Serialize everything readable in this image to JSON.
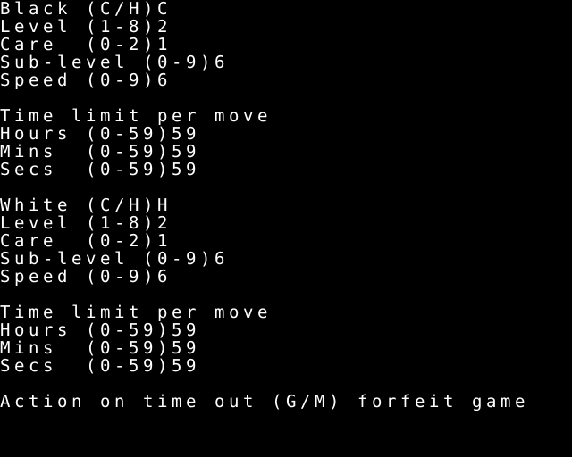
{
  "screen": {
    "title": "Chess Program Settings Screen",
    "background_color": "#000000",
    "foreground_color": "#ffffff",
    "columns": 40,
    "rows": 24,
    "char_width": 16,
    "line_height": 20
  },
  "sections": {
    "black": {
      "heading_label": "Black",
      "settings": [
        {
          "label": "Black",
          "range": "(C/H)",
          "value": "C",
          "value_column": 11
        },
        {
          "label": "Level",
          "range": "(1-8)",
          "value": "2",
          "value_column": 11
        },
        {
          "label": "Care",
          "range": "(0-2)",
          "value": "1",
          "value_column": 11
        },
        {
          "label": "Sub-level",
          "range": "(0-9)",
          "value": "6",
          "value_column": 15
        },
        {
          "label": "Speed",
          "range": "(0-9)",
          "value": "6",
          "value_column": 11
        }
      ],
      "time_limit": {
        "heading": "Time limit per move",
        "fields": [
          {
            "label": "Hours",
            "range": "(0-59)",
            "value": "59"
          },
          {
            "label": "Mins",
            "range": "(0-59)",
            "value": "59"
          },
          {
            "label": "Secs",
            "range": "(0-59)",
            "value": "59"
          }
        ]
      }
    },
    "white": {
      "heading_label": "White",
      "settings": [
        {
          "label": "White",
          "range": "(C/H)",
          "value": "H",
          "value_column": 11
        },
        {
          "label": "Level",
          "range": "(1-8)",
          "value": "2",
          "value_column": 11
        },
        {
          "label": "Care",
          "range": "(0-2)",
          "value": "1",
          "value_column": 11
        },
        {
          "label": "Sub-level",
          "range": "(0-9)",
          "value": "6",
          "value_column": 15
        },
        {
          "label": "Speed",
          "range": "(0-9)",
          "value": "6",
          "value_column": 11
        }
      ],
      "time_limit": {
        "heading": "Time limit per move",
        "fields": [
          {
            "label": "Hours",
            "range": "(0-59)",
            "value": "59"
          },
          {
            "label": "Mins",
            "range": "(0-59)",
            "value": "59"
          },
          {
            "label": "Secs",
            "range": "(0-59)",
            "value": "59"
          }
        ]
      }
    },
    "timeout_action": {
      "label": "Action on time out",
      "range": "(G/M)",
      "value": "forfeit game"
    }
  },
  "lines": [
    {
      "id": "black-player-type",
      "text": "Black (C/H)C",
      "interactable": true
    },
    {
      "id": "black-level",
      "text": "Level (1-8)2",
      "interactable": true
    },
    {
      "id": "black-care",
      "text": "Care  (0-2)1",
      "interactable": true
    },
    {
      "id": "black-sub-level",
      "text": "Sub-level (0-9)6",
      "interactable": true
    },
    {
      "id": "black-speed",
      "text": "Speed (0-9)6",
      "interactable": true
    },
    {
      "id": "blank-1",
      "text": "",
      "interactable": false
    },
    {
      "id": "black-time-heading",
      "text": "Time limit per move",
      "interactable": false
    },
    {
      "id": "black-hours",
      "text": "Hours (0-59)59",
      "interactable": true
    },
    {
      "id": "black-mins",
      "text": "Mins  (0-59)59",
      "interactable": true
    },
    {
      "id": "black-secs",
      "text": "Secs  (0-59)59",
      "interactable": true
    },
    {
      "id": "blank-2",
      "text": "",
      "interactable": false
    },
    {
      "id": "white-player-type",
      "text": "White (C/H)H",
      "interactable": true
    },
    {
      "id": "white-level",
      "text": "Level (1-8)2",
      "interactable": true
    },
    {
      "id": "white-care",
      "text": "Care  (0-2)1",
      "interactable": true
    },
    {
      "id": "white-sub-level",
      "text": "Sub-level (0-9)6",
      "interactable": true
    },
    {
      "id": "white-speed",
      "text": "Speed (0-9)6",
      "interactable": true
    },
    {
      "id": "blank-3",
      "text": "",
      "interactable": false
    },
    {
      "id": "white-time-heading",
      "text": "Time limit per move",
      "interactable": false
    },
    {
      "id": "white-hours",
      "text": "Hours (0-59)59",
      "interactable": true
    },
    {
      "id": "white-mins",
      "text": "Mins  (0-59)59",
      "interactable": true
    },
    {
      "id": "white-secs",
      "text": "Secs  (0-59)59",
      "interactable": true
    },
    {
      "id": "blank-4",
      "text": "",
      "interactable": false
    },
    {
      "id": "timeout-action",
      "text": "Action on time out (G/M) forfeit game",
      "interactable": true
    }
  ]
}
